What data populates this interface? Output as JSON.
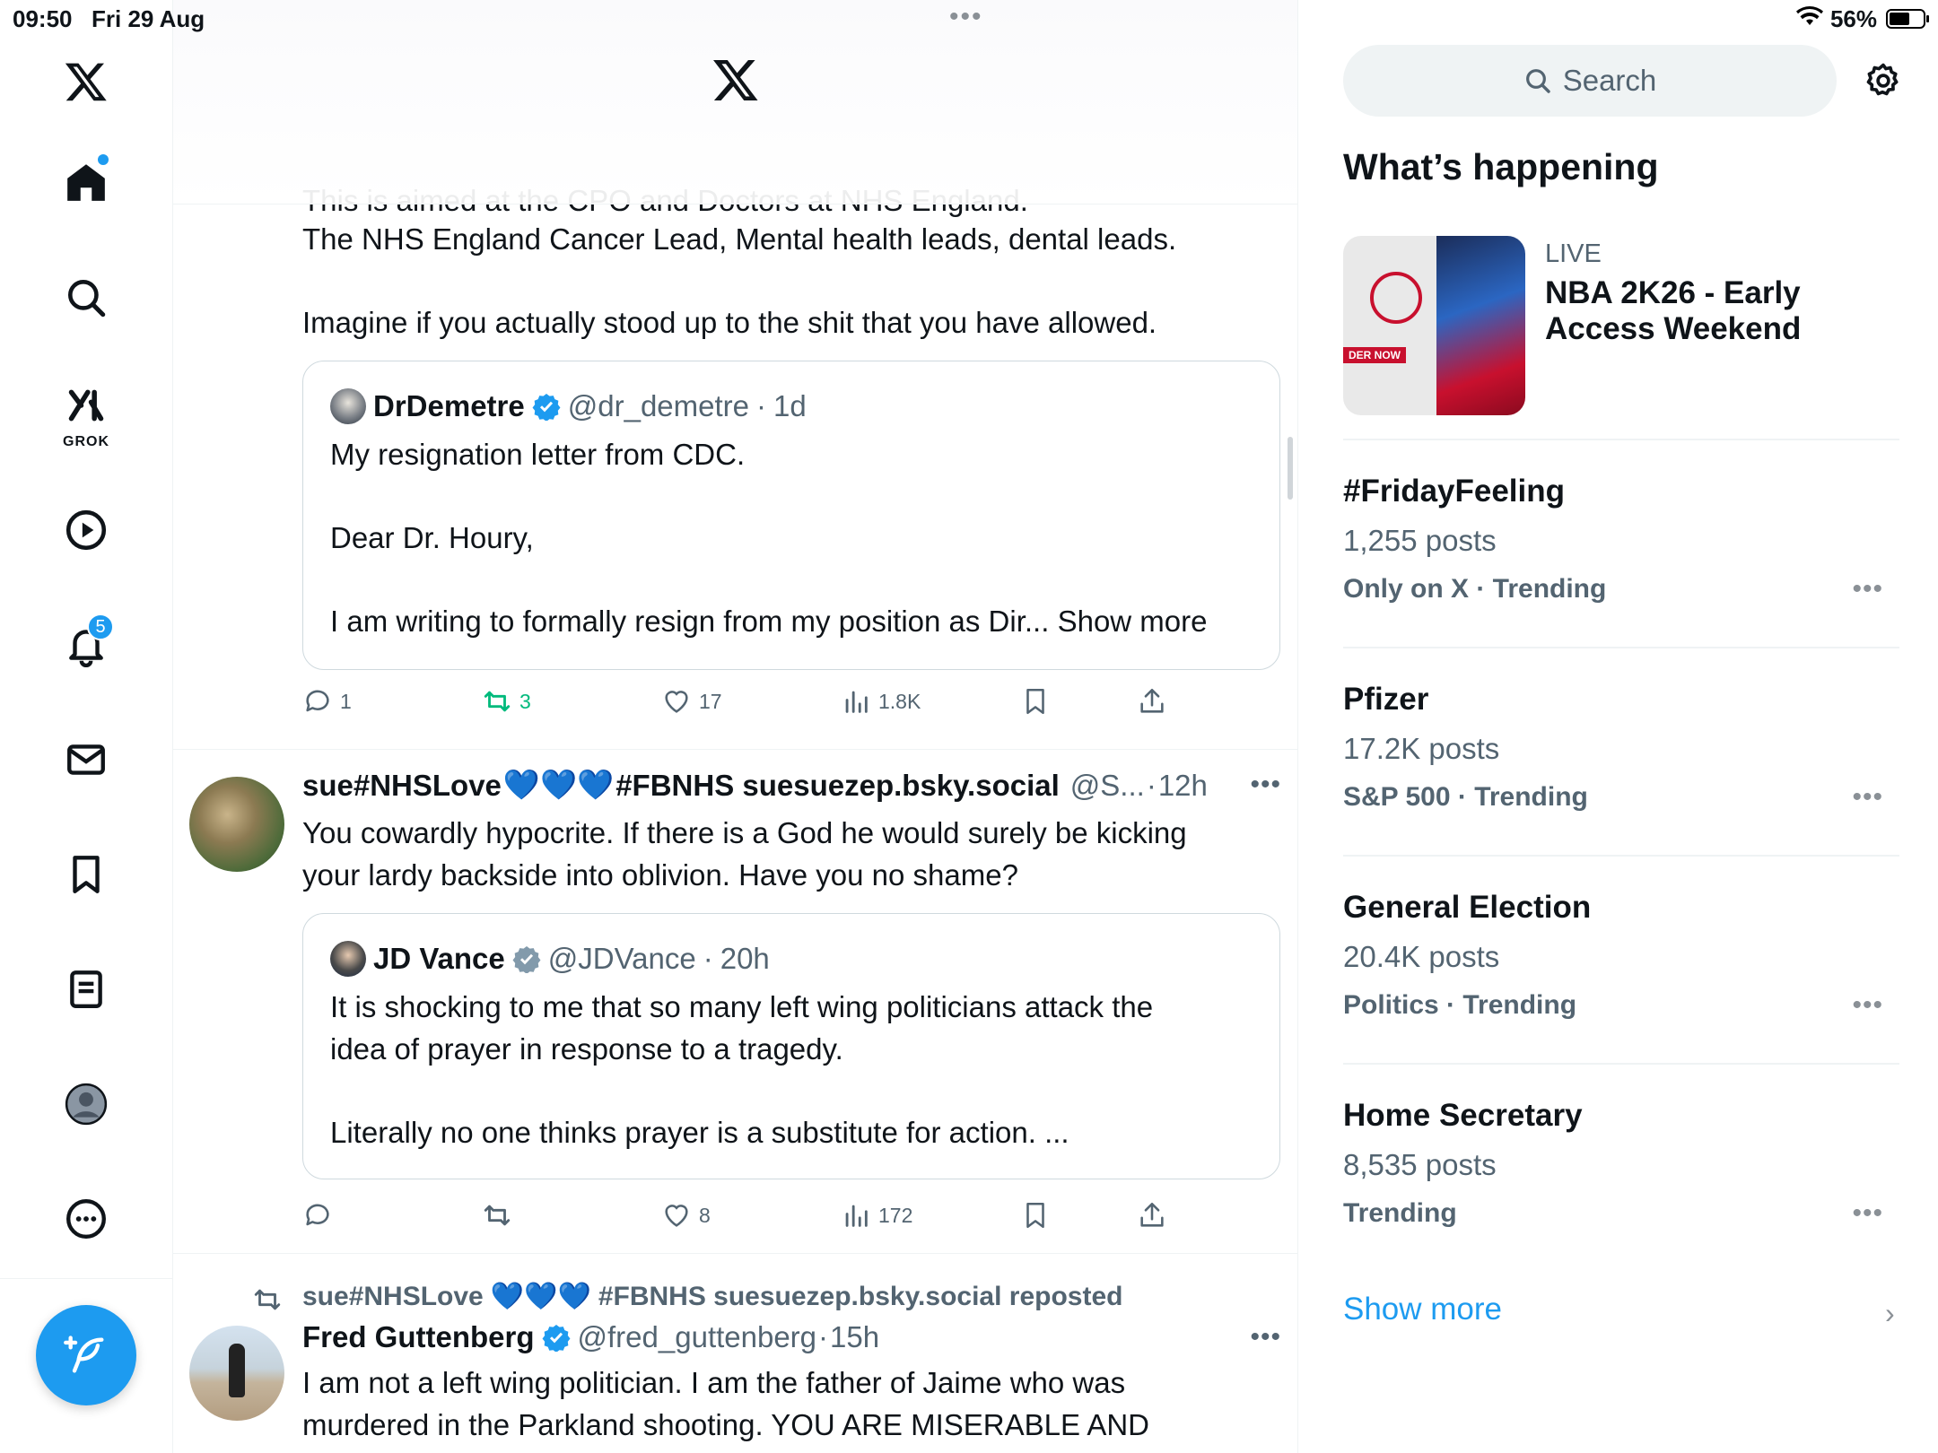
{
  "status_bar": {
    "time": "09:50",
    "date": "Fri 29 Aug",
    "battery": "56%"
  },
  "nav": {
    "items": [
      "home",
      "explore",
      "grok",
      "videos",
      "notifications",
      "messages",
      "bookmarks",
      "lists",
      "profile",
      "more"
    ],
    "grok_label": "GROK",
    "notifications_badge": "5"
  },
  "feed": {
    "clipped_text": "This is aimed at the CPO and Doctors at NHS England.",
    "post1": {
      "text_line1": "The NHS England Cancer Lead, Mental health leads, dental leads.",
      "text_line2": "Imagine if you actually stood up to the shit that you have allowed.",
      "quote": {
        "name": "DrDemetre",
        "handle": "@dr_demetre",
        "sep": "·",
        "time": "1d",
        "line1": "My resignation letter from CDC.",
        "line2": "Dear Dr. Houry,",
        "line3": "I am writing to formally resign from my position as Dir...",
        "show_more": "Show more"
      },
      "actions": {
        "replies": "1",
        "reposts": "3",
        "likes": "17",
        "views": "1.8K"
      }
    },
    "post2": {
      "name_part1": "sue#NHSLove",
      "hearts": "💙💙💙",
      "name_part2": "#FBNHS suesuezep.bsky.social",
      "handle": "@S...",
      "sep": "·",
      "time": "12h",
      "text_line1": "You cowardly hypocrite. If there is a God he would surely be kicking",
      "text_line2": "your lardy backside into oblivion. Have you no shame?",
      "quote": {
        "name": "JD Vance",
        "handle": "@JDVance",
        "sep": "·",
        "time": "20h",
        "line1": "It is shocking to me that so many left wing politicians attack the",
        "line2": "idea of prayer in response to a tragedy.",
        "line3": "Literally no one thinks prayer is a substitute for action. ..."
      },
      "actions": {
        "likes": "8",
        "views": "172"
      }
    },
    "post3": {
      "repost_by_part1": "sue#NHSLove",
      "repost_hearts": "💙💙💙",
      "repost_by_part2": "#FBNHS suesuezep.bsky.social reposted",
      "name": "Fred Guttenberg",
      "handle": "@fred_guttenberg",
      "sep": "·",
      "time": "15h",
      "text_line1": "I am not a left wing politician.  I am the father of Jaime who was",
      "text_line2": "murdered in the Parkland shooting.   YOU ARE MISERABLE AND"
    }
  },
  "sidebar": {
    "search_placeholder": "Search",
    "heading": "What’s happening",
    "live": {
      "label": "LIVE",
      "title": "NBA 2K26 - Early Access Weekend",
      "thumb_tag": "DER NOW"
    },
    "trends": [
      {
        "name": "#FridayFeeling",
        "posts": "1,255 posts",
        "context": "Only on X · Trending"
      },
      {
        "name": "Pfizer",
        "posts": "17.2K posts",
        "context": "S&P 500 · Trending"
      },
      {
        "name": "General Election",
        "posts": "20.4K posts",
        "context": "Politics · Trending"
      },
      {
        "name": "Home Secretary",
        "posts": "8,535 posts",
        "context": "Trending"
      }
    ],
    "show_more": "Show more"
  },
  "colors": {
    "accent": "#1d9bf0",
    "text": "#0f1419",
    "muted": "#536471",
    "repost_green": "#00ba7c",
    "border": "#cfd9de"
  }
}
